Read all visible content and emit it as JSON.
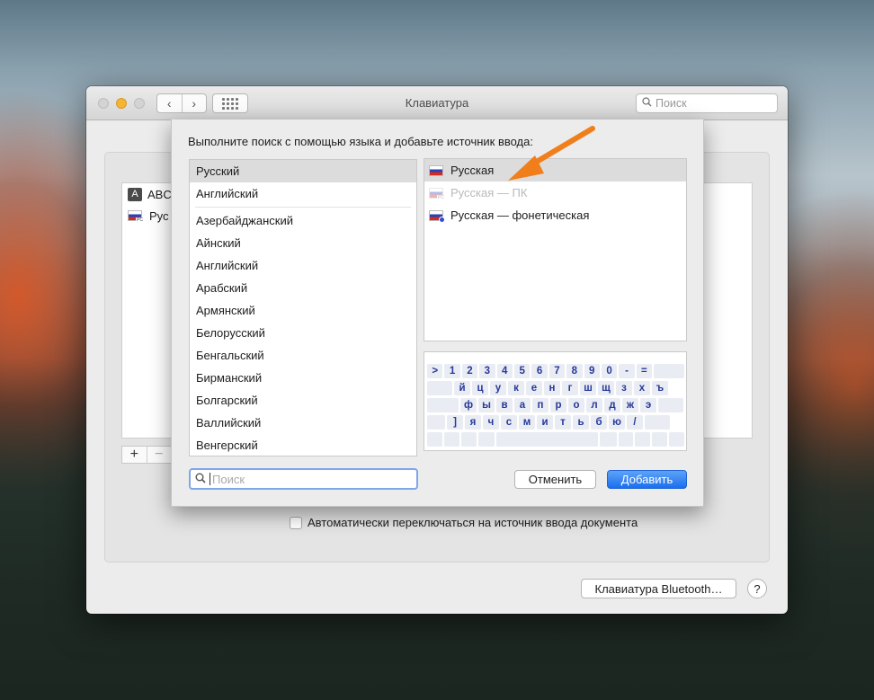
{
  "window": {
    "title": "Клавиатура",
    "search_placeholder": "Поиск",
    "nav_back": "‹",
    "nav_forward": "›"
  },
  "background_sources": [
    {
      "label": "ABC",
      "icon": "abc-icon"
    },
    {
      "label": "Рус",
      "icon": "russian-flag-icon"
    }
  ],
  "add_remove": {
    "add": "+",
    "remove": "−"
  },
  "auto_switch": {
    "label": "Автоматически переключаться на источник ввода документа",
    "checked": false
  },
  "bluetooth_button": "Клавиатура Bluetooth…",
  "help_button": "?",
  "sheet": {
    "heading": "Выполните поиск с помощью языка и добавьте источник ввода:",
    "languages_top": [
      "Русский",
      "Английский"
    ],
    "languages": [
      "Азербайджанский",
      "Айнский",
      "Английский",
      "Арабский",
      "Армянский",
      "Белорусский",
      "Бенгальский",
      "Бирманский",
      "Болгарский",
      "Валлийский",
      "Венгерский"
    ],
    "selected_language": "Русский",
    "sources": [
      {
        "label": "Русская",
        "state": "selected",
        "icon": "russian-flag-icon"
      },
      {
        "label": "Русская — ПК",
        "state": "disabled",
        "icon": "russian-pc-flag-icon"
      },
      {
        "label": "Русская — фонетическая",
        "state": "normal",
        "icon": "russian-phonetic-flag-icon"
      }
    ],
    "keyboard": {
      "row1": [
        ">",
        "1",
        "2",
        "3",
        "4",
        "5",
        "6",
        "7",
        "8",
        "9",
        "0",
        "-",
        "="
      ],
      "row2": [
        "й",
        "ц",
        "у",
        "к",
        "е",
        "н",
        "г",
        "ш",
        "щ",
        "з",
        "х",
        "ъ"
      ],
      "row3": [
        "ф",
        "ы",
        "в",
        "а",
        "п",
        "р",
        "о",
        "л",
        "д",
        "ж",
        "э"
      ],
      "row4": [
        "]",
        "я",
        "ч",
        "с",
        "м",
        "и",
        "т",
        "ь",
        "б",
        "ю",
        "/"
      ]
    },
    "search_placeholder": "Поиск",
    "cancel_button": "Отменить",
    "add_button": "Добавить"
  },
  "colors": {
    "accent": "#1a6ff0",
    "arrow": "#f07f1b"
  }
}
